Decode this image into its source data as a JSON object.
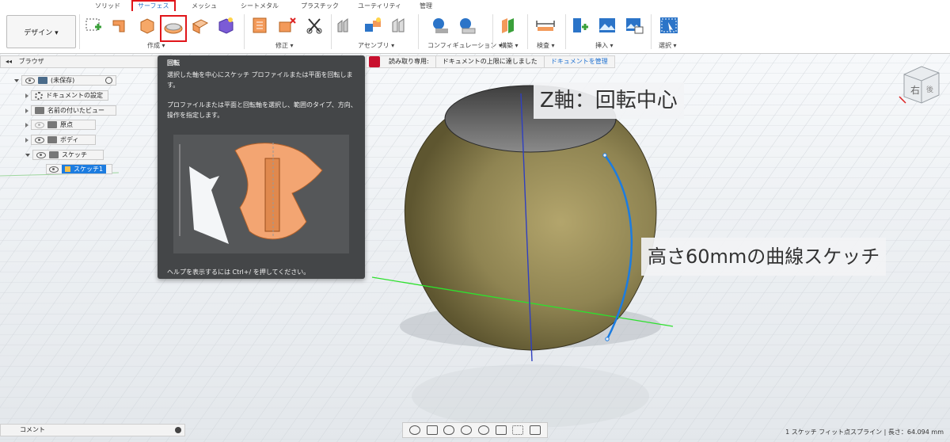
{
  "tabs": [
    "ソリッド",
    "サーフェス",
    "メッシュ",
    "シートメタル",
    "プラスチック",
    "ユーティリティ",
    "管理"
  ],
  "active_tab_index": 1,
  "workspace_button": "デザイン ▾",
  "ribbon_groups": {
    "create": "作成 ▾",
    "modify": "修正 ▾",
    "assemble": "アセンブリ ▾",
    "configure": "コンフィギュレーション ▾",
    "construct": "構築 ▾",
    "inspect": "検査 ▾",
    "insert": "挿入 ▾",
    "select": "選択 ▾"
  },
  "browser": {
    "header": "ブラウザ",
    "items": [
      {
        "label": "(未保存)",
        "kind": "root"
      },
      {
        "label": "ドキュメントの設定",
        "kind": "settings"
      },
      {
        "label": "名前の付いたビュー",
        "kind": "folder"
      },
      {
        "label": "原点",
        "kind": "folder"
      },
      {
        "label": "ボディ",
        "kind": "folder"
      },
      {
        "label": "スケッチ",
        "kind": "folder"
      },
      {
        "label": "スケッチ1",
        "kind": "sketch"
      }
    ]
  },
  "tooltip": {
    "title": "回転",
    "desc1": "選択した軸を中心にスケッチ プロファイルまたは平面を回転します。",
    "desc2": "プロファイルまたは平面と回転軸を選択し、範囲のタイプ、方向、操作を指定します。",
    "help": "ヘルプを表示するには Ctrl+/ を押してください。"
  },
  "readonly_banner": {
    "label": "読み取り専用:",
    "message": "ドキュメントの上限に達しました",
    "button": "ドキュメントを管理"
  },
  "annotations": {
    "axis_label": "Z軸：回転中心",
    "sketch_label": "高さ60mmの曲線スケッチ"
  },
  "viewcube": {
    "face": "右",
    "side": "後"
  },
  "comment_bar": "コメント",
  "status_text": "1 スケッチ フィット点スプライン | 長さ：64.094 mm",
  "colors": {
    "accent": "#1c7ce0",
    "highlight_red": "#e1151a",
    "body_fill": "#8f8452",
    "tooltip_bg": "#444648"
  }
}
